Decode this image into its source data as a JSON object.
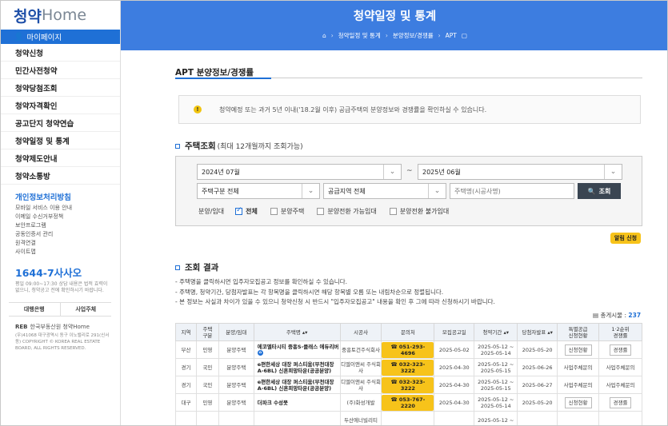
{
  "sidebar": {
    "logo_part1": "청약",
    "logo_part2": "Home",
    "mypage": "마이페이지",
    "items": [
      {
        "label": "청약신청"
      },
      {
        "label": "민간사전청약"
      },
      {
        "label": "청약당첨조회"
      },
      {
        "label": "청약자격확인"
      },
      {
        "label": "공고단지 청약연습"
      },
      {
        "label": "청약일정 및 통계"
      },
      {
        "label": "청약제도안내"
      },
      {
        "label": "청약소통방"
      }
    ],
    "policy_title": "개인정보처리방침",
    "sublinks": [
      "모바일 서비스 이용 안내",
      "이메일 수신거부정책",
      "보안프로그램",
      "공동인증서 관리",
      "원격연결",
      "사이트맵"
    ],
    "callcenter": "1644-7사사오",
    "callnote": "평일 09:00~17:30 상담 내용은 법적 효력이 없으니, 청약공고 전에 확인하시기 바랍니다.",
    "btn_bank": "대행은행",
    "btn_body": "사업주체",
    "reb_label": "한국부동산원 청약Home",
    "reb_note": "(우)41068 대구광역시 동구 이노밸리로 291(신서동) COPYRIGHT © KOREA REAL ESTATE BOARD, ALL RIGHTS RESERVED."
  },
  "header": {
    "title": "청약일정 및 통계",
    "crumb1": "청약일정 및 통계",
    "crumb2": "분양정보/경쟁률",
    "crumb3": "APT"
  },
  "main": {
    "section_title": "APT 분양정보/경쟁률",
    "notice": "청약예정 또는 과거 5년 이내('18.2월 이후) 공급주택의 분양정보와 경쟁률을 확인하실 수 있습니다.",
    "search_title": "주택조회",
    "search_sub": "(최대 12개월까지 조회가능)",
    "from_month": "2024년 07월",
    "tilde": "~",
    "to_month": "2025년 06월",
    "house_type": "주택구분 전체",
    "region": "공급지역 전체",
    "name_placeholder": "주택명(시공사명)",
    "search_btn": "조회",
    "sale_label": "분양/임대",
    "checks": [
      "전체",
      "분양주택",
      "분양전환 가능임대",
      "분양전환 불가임대"
    ],
    "alarm_btn": "알림 신청",
    "results_title": "조회 결과",
    "notes": [
      "- 주택명을 클릭하시면 입주자모집공고 정보를 확인하실 수 있습니다.",
      "- 주택명, 청약기간, 당첨자발표는 각 항목명을 클릭하시면 해당 항목별 오름 또는 내림차순으로 정렬됩니다.",
      "- 본 정보는 사실과 차이가 있을 수 있으니 청약신청 시 반드시 \"입주자모집공고\" 내용을 확인 후 그에 따라 신청하시기 바랍니다."
    ],
    "total_label": "총게시물 :",
    "total_count": "237"
  },
  "table": {
    "headers": [
      "지역",
      "주택\n구분",
      "분양/임대",
      "주택명 ▴▾",
      "시공사",
      "문의처",
      "모집공고일",
      "청약기간 ▴▾",
      "당첨자발표 ▴▾",
      "특별공급\n신청현황",
      "1·2순위\n경쟁률"
    ],
    "rows": [
      {
        "region": "부산",
        "type": "민영",
        "sale": "분양주택",
        "name": "에코델타시티 중흥S-클래스 에듀리버",
        "builder": "중흥토건주식회사",
        "phone": "051-293-4696",
        "notice": "2025-05-02",
        "period": "2025-05-12 ~ 2025-05-14",
        "winner": "2025-05-20",
        "special": "신청현황",
        "rank": "경쟁률"
      },
      {
        "region": "경기",
        "type": "국민",
        "sale": "분양주택",
        "name": "e편한세상 대장 퍼스티움(부천대장 A-6BL) 신혼희망타운(공공분양)",
        "builder": "디엘이앤씨 주식회사",
        "phone": "032-323-3222",
        "notice": "2025-04-30",
        "period": "2025-05-12 ~ 2025-05-15",
        "winner": "2025-06-26",
        "special": "사업주체문의",
        "rank": "사업주체문의"
      },
      {
        "region": "경기",
        "type": "국민",
        "sale": "분양주택",
        "name": "e편한세상 대장 퍼스티움(부천대장 A-6BL) 신혼희망타운(공공분양)",
        "builder": "디엘이앤씨 주식회사",
        "phone": "032-323-3222",
        "notice": "2025-04-30",
        "period": "2025-05-12 ~ 2025-05-15",
        "winner": "2025-06-27",
        "special": "사업주체문의",
        "rank": "사업주체문의"
      },
      {
        "region": "대구",
        "type": "민영",
        "sale": "분양주택",
        "name": "더파크 수성못",
        "builder": "(주)화성개발",
        "phone": "053-767-2220",
        "notice": "2025-04-30",
        "period": "2025-05-12 ~ 2025-05-14",
        "winner": "2025-05-20",
        "special": "신청현황",
        "rank": "경쟁률"
      },
      {
        "region": "",
        "type": "",
        "sale": "",
        "name": "",
        "builder": "두산에너빌리티",
        "phone": "",
        "notice": "",
        "period": "2025-05-12 ~",
        "winner": "",
        "special": "",
        "rank": ""
      }
    ]
  }
}
